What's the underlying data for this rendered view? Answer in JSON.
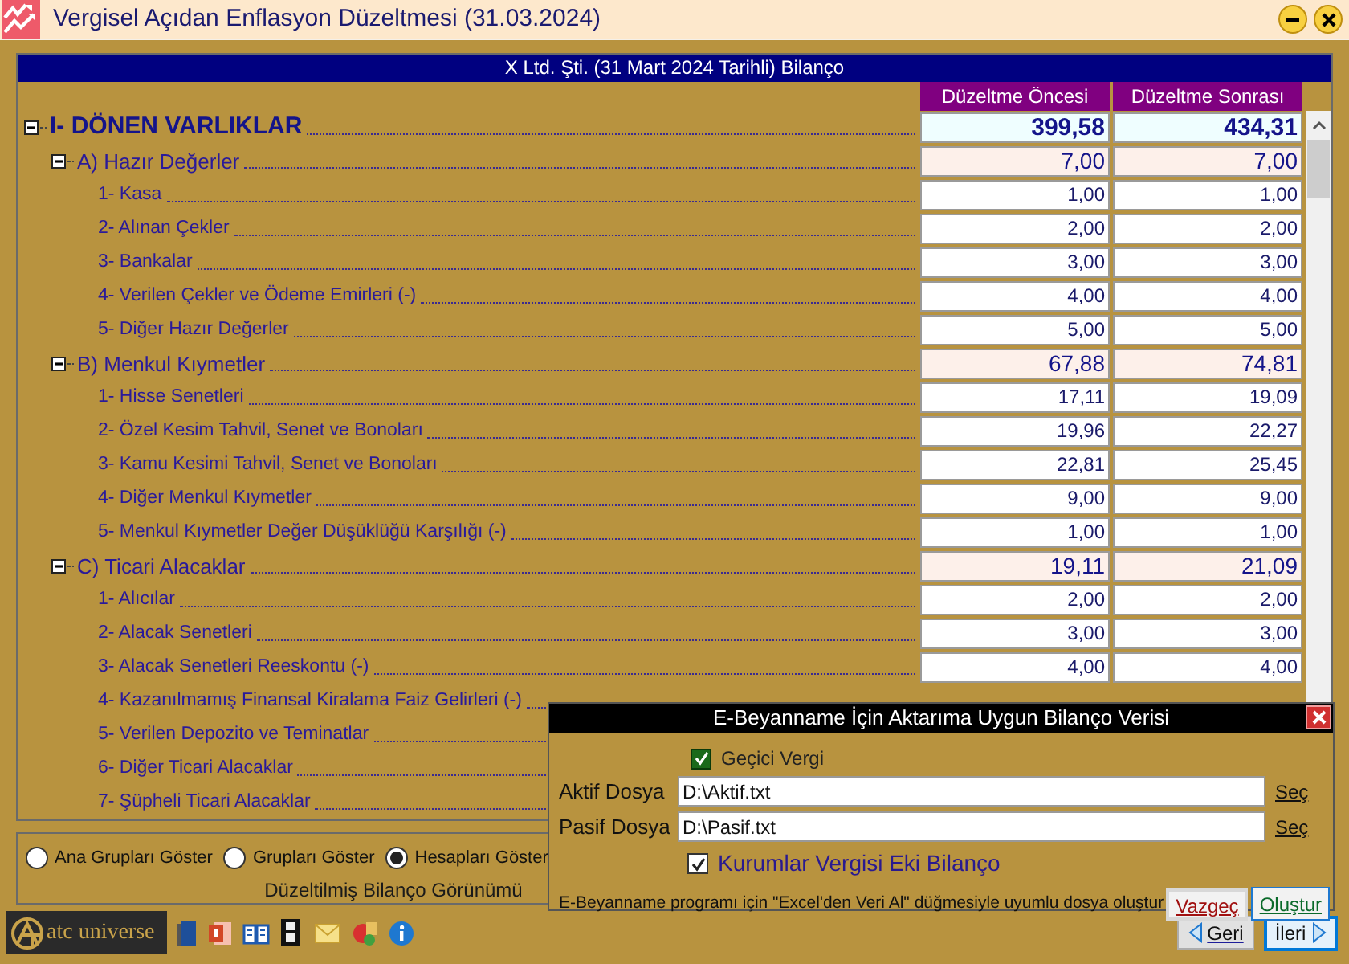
{
  "window": {
    "title": "Vergisel Açıdan Enflasyon Düzeltmesi (31.03.2024)"
  },
  "balance": {
    "title": "X Ltd. Şti. (31 Mart 2024 Tarihli) Bilanço",
    "columns": [
      "Düzeltme Öncesi",
      "Düzeltme Sonrası"
    ],
    "rows": [
      {
        "kind": "section",
        "label": "I- DÖNEN VARLIKLAR",
        "expanded": true,
        "values": [
          "399,58",
          "434,31"
        ],
        "children": [
          {
            "kind": "group",
            "label": "A) Hazır Değerler",
            "expanded": true,
            "values": [
              "7,00",
              "7,00"
            ],
            "children": [
              {
                "kind": "account",
                "label": "1- Kasa",
                "values": [
                  "1,00",
                  "1,00"
                ]
              },
              {
                "kind": "account",
                "label": "2- Alınan Çekler",
                "values": [
                  "2,00",
                  "2,00"
                ]
              },
              {
                "kind": "account",
                "label": "3- Bankalar",
                "values": [
                  "3,00",
                  "3,00"
                ]
              },
              {
                "kind": "account",
                "label": "4- Verilen Çekler ve Ödeme Emirleri (-)",
                "values": [
                  "4,00",
                  "4,00"
                ]
              },
              {
                "kind": "account",
                "label": "5- Diğer Hazır Değerler",
                "values": [
                  "5,00",
                  "5,00"
                ]
              }
            ]
          },
          {
            "kind": "group",
            "label": "B) Menkul Kıymetler",
            "expanded": true,
            "values": [
              "67,88",
              "74,81"
            ],
            "children": [
              {
                "kind": "account",
                "label": "1- Hisse Senetleri",
                "values": [
                  "17,11",
                  "19,09"
                ]
              },
              {
                "kind": "account",
                "label": "2- Özel Kesim Tahvil, Senet ve Bonoları",
                "values": [
                  "19,96",
                  "22,27"
                ]
              },
              {
                "kind": "account",
                "label": "3- Kamu Kesimi Tahvil, Senet ve Bonoları",
                "values": [
                  "22,81",
                  "25,45"
                ]
              },
              {
                "kind": "account",
                "label": "4- Diğer Menkul Kıymetler",
                "values": [
                  "9,00",
                  "9,00"
                ]
              },
              {
                "kind": "account",
                "label": "5- Menkul Kıymetler Değer Düşüklüğü Karşılığı (-)",
                "values": [
                  "1,00",
                  "1,00"
                ]
              }
            ]
          },
          {
            "kind": "group",
            "label": "C) Ticari Alacaklar",
            "expanded": true,
            "values": [
              "19,11",
              "21,09"
            ],
            "children": [
              {
                "kind": "account",
                "label": "1- Alıcılar",
                "values": [
                  "2,00",
                  "2,00"
                ]
              },
              {
                "kind": "account",
                "label": "2- Alacak Senetleri",
                "values": [
                  "3,00",
                  "3,00"
                ]
              },
              {
                "kind": "account",
                "label": "3- Alacak Senetleri Reeskontu (-)",
                "values": [
                  "4,00",
                  "4,00"
                ]
              },
              {
                "kind": "account",
                "label": "4- Kazanılmamış Finansal Kiralama Faiz Gelirleri (-)"
              },
              {
                "kind": "account",
                "label": "5- Verilen Depozito ve Teminatlar"
              },
              {
                "kind": "account",
                "label": "6- Diğer Ticari Alacaklar"
              },
              {
                "kind": "account",
                "label": "7- Şüpheli Ticari Alacaklar"
              }
            ]
          }
        ]
      }
    ]
  },
  "view_options": {
    "caption": "Düzeltilmiş Bilanço Görünümü",
    "options": [
      {
        "label": "Ana Grupları Göster",
        "selected": false
      },
      {
        "label": "Grupları Göster",
        "selected": false
      },
      {
        "label": "Hesapları Göster",
        "selected": true
      }
    ]
  },
  "toolbar": {
    "logo": "atc universe"
  },
  "navigation": {
    "back": "Geri",
    "next": "İleri"
  },
  "dialog": {
    "title": "E-Beyanname İçin Aktarıma Uygun Bilanço Verisi",
    "provisional_tax": {
      "label": "Geçici Vergi",
      "checked": true
    },
    "files": [
      {
        "label": "Aktif Dosya",
        "value": "D:\\Aktif.txt",
        "link": "Seç"
      },
      {
        "label": "Pasif Dosya",
        "value": "D:\\Pasif.txt",
        "link": "Seç"
      }
    ],
    "corporate_tax": {
      "label": "Kurumlar Vergisi Eki Bilanço",
      "checked": true
    },
    "note": "E-Beyanname programı için \"Excel'den Veri Al\" düğmesiyle uyumlu dosya oluştur",
    "buttons": {
      "cancel": "Vazgeç",
      "create": "Oluştur"
    }
  }
}
